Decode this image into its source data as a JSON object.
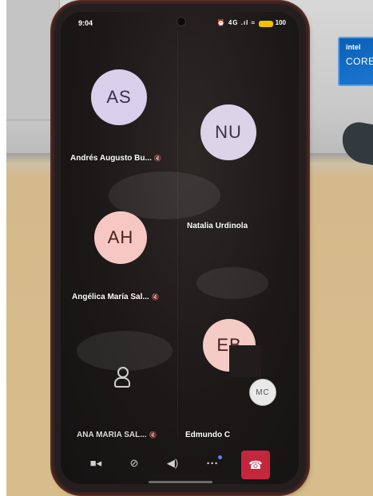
{
  "status_bar": {
    "time": "9:04",
    "icons": "⏰ 4G .ıl ≈",
    "battery": "100"
  },
  "participants": [
    {
      "initials": "AS",
      "name": "Andrés Augusto Bu..."
    },
    {
      "initials": "NU",
      "name": "Natalia Urdinola"
    },
    {
      "initials": "AH",
      "name": "Angélica María Sal..."
    },
    {
      "initials": "EB",
      "name": "Edmundo C"
    }
  ],
  "self_view": {
    "initials": "MC"
  },
  "other_participant": {
    "name": "ANA MARIA SAL..."
  },
  "controls": {
    "video": "video-off-icon",
    "mic": "mic-off-icon",
    "speaker": "speaker-icon",
    "more": "more-icon",
    "hangup": "hangup-icon"
  },
  "colors": {
    "hangup": "#c4263c",
    "avatar_lilac": "#d8d0ea",
    "avatar_pink": "#f7c8c3"
  }
}
